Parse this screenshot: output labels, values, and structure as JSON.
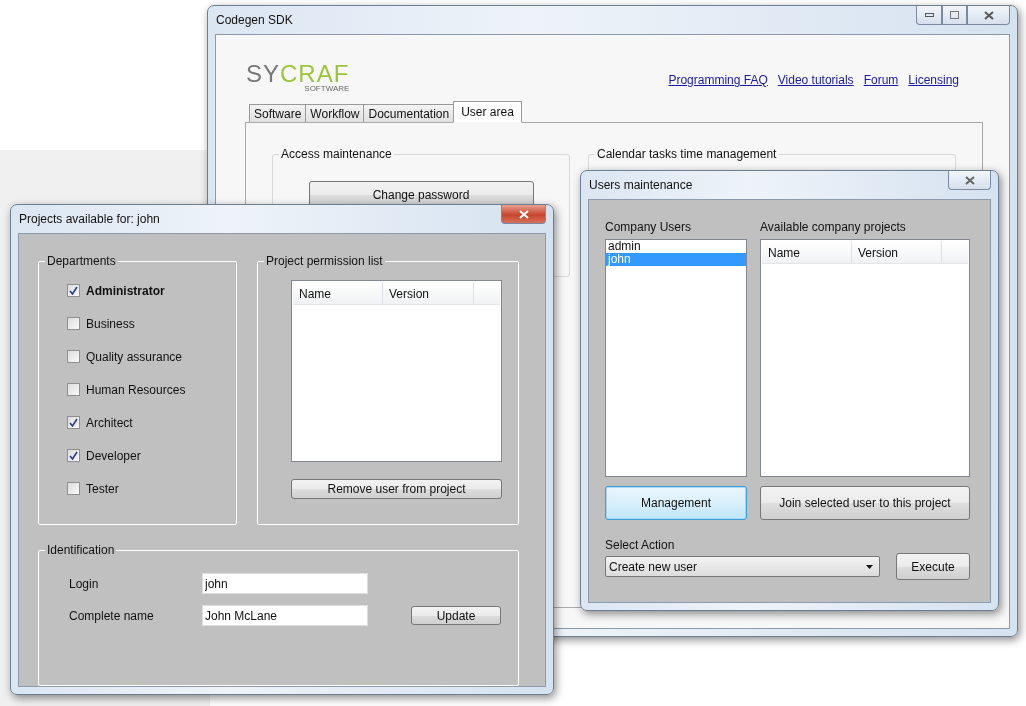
{
  "main_window": {
    "title": "Codegen SDK",
    "logo": {
      "part_1": "SY",
      "part_2": "CRAF",
      "tagline": "SOFTWARE"
    },
    "links": [
      "Programming FAQ",
      "Video tutorials",
      "Forum",
      "Licensing"
    ],
    "tabs": [
      {
        "label": "Software",
        "selected": false
      },
      {
        "label": "Workflow",
        "selected": false
      },
      {
        "label": "Documentation",
        "selected": false
      },
      {
        "label": "User area",
        "selected": true
      }
    ],
    "access_group": {
      "title": "Access maintenance",
      "button": "Change password"
    },
    "calendar_group": {
      "title": "Calendar tasks time management"
    }
  },
  "users_window": {
    "title": "Users maintenance",
    "users_label": "Company Users",
    "users": [
      {
        "name": "admin",
        "selected": false
      },
      {
        "name": "john",
        "selected": true
      }
    ],
    "projects_label": "Available company projects",
    "columns": [
      "Name",
      "Version"
    ],
    "buttons": [
      {
        "label": "Management",
        "focused": true
      },
      {
        "label": "Join selected user to this project",
        "focused": false
      }
    ],
    "action_label": "Select Action",
    "action_value": "Create new user",
    "execute": "Execute"
  },
  "projects_window": {
    "title": "Projects available for: john",
    "departments": {
      "title": "Departments",
      "items": [
        {
          "label": "Administrator",
          "checked": true,
          "bold": true
        },
        {
          "label": "Business",
          "checked": false,
          "bold": false
        },
        {
          "label": "Quality assurance",
          "checked": false,
          "bold": false
        },
        {
          "label": "Human Resources",
          "checked": false,
          "bold": false
        },
        {
          "label": "Architect",
          "checked": true,
          "bold": false
        },
        {
          "label": "Developer",
          "checked": true,
          "bold": false
        },
        {
          "label": "Tester",
          "checked": false,
          "bold": false
        }
      ]
    },
    "permissions": {
      "title": "Project permission list",
      "columns": [
        "Name",
        "Version"
      ],
      "button": "Remove user from project"
    },
    "identification": {
      "title": "Identification",
      "fields": [
        {
          "label": "Login",
          "value": "john"
        },
        {
          "label": "Complete name",
          "value": "John McLane"
        }
      ],
      "button": "Update"
    }
  }
}
